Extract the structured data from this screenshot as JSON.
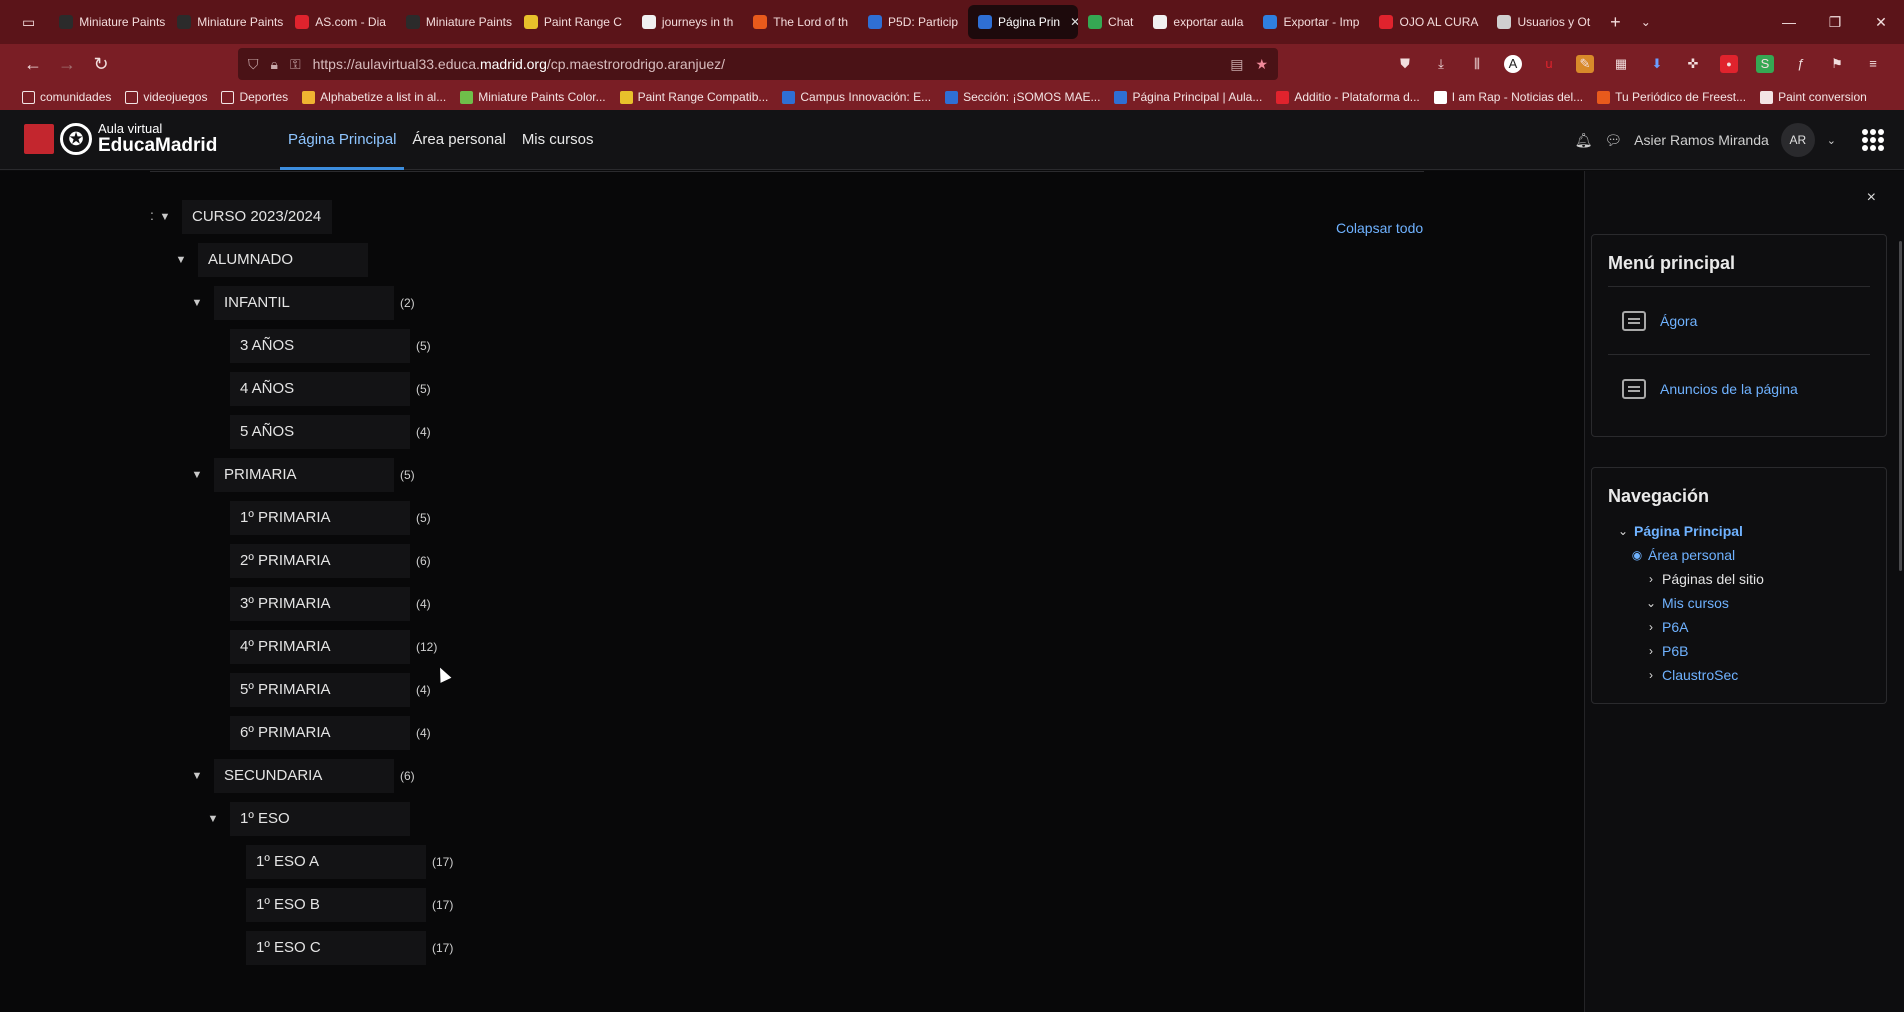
{
  "browser": {
    "tabs": [
      {
        "label": "Miniature Paints (",
        "color": "#2b2b2b"
      },
      {
        "label": "Miniature Paints (",
        "color": "#2b2b2b"
      },
      {
        "label": "AS.com - Dia",
        "color": "#e0232d"
      },
      {
        "label": "Miniature Paints (",
        "color": "#2b2b2b"
      },
      {
        "label": "Paint Range C",
        "color": "#e8c12b"
      },
      {
        "label": "journeys in th",
        "color": "#f0f0f0"
      },
      {
        "label": "The Lord of th",
        "color": "#e85a1c"
      },
      {
        "label": "P5D: Particip",
        "color": "#2f6fd4"
      },
      {
        "label": "Página Prin",
        "color": "#2f6fd4",
        "active": true
      },
      {
        "label": "Chat",
        "color": "#35a853"
      },
      {
        "label": "exportar aula",
        "color": "#f0f0f0"
      },
      {
        "label": "Exportar - Imp",
        "color": "#2f7fe0"
      },
      {
        "label": "OJO AL CURA",
        "color": "#e0232d"
      },
      {
        "label": "Usuarios y Ot",
        "color": "#cfcfcf"
      }
    ],
    "url_prefix": "https://aulavirtual33.educa.",
    "url_domain": "madrid.org",
    "url_suffix": "/cp.maestrorodrigo.aranjuez/",
    "bookmarks": [
      {
        "label": "comunidades",
        "color": "#f3e4e4"
      },
      {
        "label": "videojuegos",
        "color": "#f3e4e4"
      },
      {
        "label": "Deportes",
        "color": "#f3e4e4"
      },
      {
        "label": "Alphabetize a list in al...",
        "color": "#f0b431"
      },
      {
        "label": "Miniature Paints Color...",
        "color": "#6fbf4a"
      },
      {
        "label": "Paint Range Compatib...",
        "color": "#e8c12b"
      },
      {
        "label": "Campus Innovación: E...",
        "color": "#2f6fd4"
      },
      {
        "label": "Sección: ¡SOMOS MAE...",
        "color": "#2f6fd4"
      },
      {
        "label": "Página Principal | Aula...",
        "color": "#2f6fd4"
      },
      {
        "label": "Additio - Plataforma d...",
        "color": "#e0232d"
      },
      {
        "label": "I am Rap - Noticias del...",
        "color": "#ffffff"
      },
      {
        "label": "Tu Periódico de Freest...",
        "color": "#e85a1c"
      },
      {
        "label": "Paint conversion",
        "color": "#f3e4e4"
      }
    ]
  },
  "site": {
    "logo_line1": "Aula virtual",
    "logo_line2": "EducaMadrid",
    "nav": [
      "Página Principal",
      "Área personal",
      "Mis cursos"
    ],
    "user_name": "Asier Ramos Miranda",
    "user_initials": "AR"
  },
  "main": {
    "colon": ":",
    "collapse_all": "Colapsar todo",
    "tree": [
      {
        "label": "CURSO 2023/2024",
        "count": "",
        "level": 0,
        "expanded": true
      },
      {
        "label": "ALUMNADO",
        "count": "",
        "level": 1,
        "expanded": true
      },
      {
        "label": "INFANTIL",
        "count": "(2)",
        "level": 2,
        "expanded": true
      },
      {
        "label": "3 AÑOS",
        "count": "(5)",
        "level": 3,
        "expanded": false
      },
      {
        "label": "4 AÑOS",
        "count": "(5)",
        "level": 3,
        "expanded": false
      },
      {
        "label": "5 AÑOS",
        "count": "(4)",
        "level": 3,
        "expanded": false
      },
      {
        "label": "PRIMARIA",
        "count": "(5)",
        "level": 2,
        "expanded": true
      },
      {
        "label": "1º PRIMARIA",
        "count": "(5)",
        "level": 3,
        "expanded": false
      },
      {
        "label": "2º PRIMARIA",
        "count": "(6)",
        "level": 3,
        "expanded": false
      },
      {
        "label": "3º PRIMARIA",
        "count": "(4)",
        "level": 3,
        "expanded": false
      },
      {
        "label": "4º PRIMARIA",
        "count": "(12)",
        "level": 3,
        "expanded": false
      },
      {
        "label": "5º PRIMARIA",
        "count": "(4)",
        "level": 3,
        "expanded": false
      },
      {
        "label": "6º PRIMARIA",
        "count": "(4)",
        "level": 3,
        "expanded": false
      },
      {
        "label": "SECUNDARIA",
        "count": "(6)",
        "level": 2,
        "expanded": true
      },
      {
        "label": "1º ESO",
        "count": "",
        "level": 3,
        "expanded": true
      },
      {
        "label": "1º ESO A",
        "count": "(17)",
        "level": 4,
        "expanded": false
      },
      {
        "label": "1º ESO B",
        "count": "(17)",
        "level": 4,
        "expanded": false
      },
      {
        "label": "1º ESO C",
        "count": "(17)",
        "level": 4,
        "expanded": false
      }
    ]
  },
  "drawer": {
    "close": "×",
    "main_menu_title": "Menú principal",
    "main_menu_items": [
      "Ágora",
      "Anuncios de la página"
    ],
    "nav_title": "Navegación",
    "nav_items": [
      {
        "label": "Página Principal",
        "indent": 0,
        "caret": "⌄",
        "style": "bold-link"
      },
      {
        "label": "Área personal",
        "indent": 1,
        "caret": "◉",
        "style": "link"
      },
      {
        "label": "Páginas del sitio",
        "indent": 2,
        "caret": "›",
        "style": "text"
      },
      {
        "label": "Mis cursos",
        "indent": 2,
        "caret": "⌄",
        "style": "link"
      },
      {
        "label": "P6A",
        "indent": 2,
        "caret": "›",
        "style": "link"
      },
      {
        "label": "P6B",
        "indent": 2,
        "caret": "›",
        "style": "link"
      },
      {
        "label": "ClaustroSec",
        "indent": 2,
        "caret": "›",
        "style": "link"
      }
    ]
  }
}
